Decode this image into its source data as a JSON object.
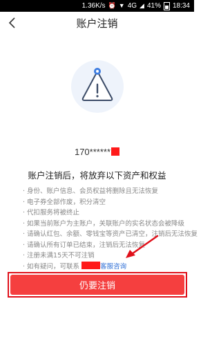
{
  "status_bar": {
    "speed": "1.36K/s",
    "network": "4G",
    "battery": "41%",
    "time": "18:34"
  },
  "nav": {
    "back_icon": "back-chevron",
    "title": "账户注销"
  },
  "account": {
    "phone": "170******"
  },
  "notice": {
    "heading": "账户注销后，将放弃以下资产和权益",
    "items": [
      "· 身份、账户信息、会员权益将删除且无法恢复",
      "· 电子券全部作废，积分清空",
      "· 代扣服务将被终止",
      "· 如果当前账户为主账户，关联账户的实名状态会被降级",
      "· 请确认红包、余额、零钱宝等资产已清空，注销后无法恢复",
      "· 请确认所有订单已结束，注销后无法恢复",
      "· 注册未满15天不可注销"
    ],
    "contact_prefix": "· 如有疑问，可联系",
    "contact_link": "客服咨询"
  },
  "actions": {
    "primary_label": "仍要注销"
  },
  "colors": {
    "accent": "#f53f3f",
    "highlight": "#e0101a",
    "link": "#2f6fd6"
  }
}
